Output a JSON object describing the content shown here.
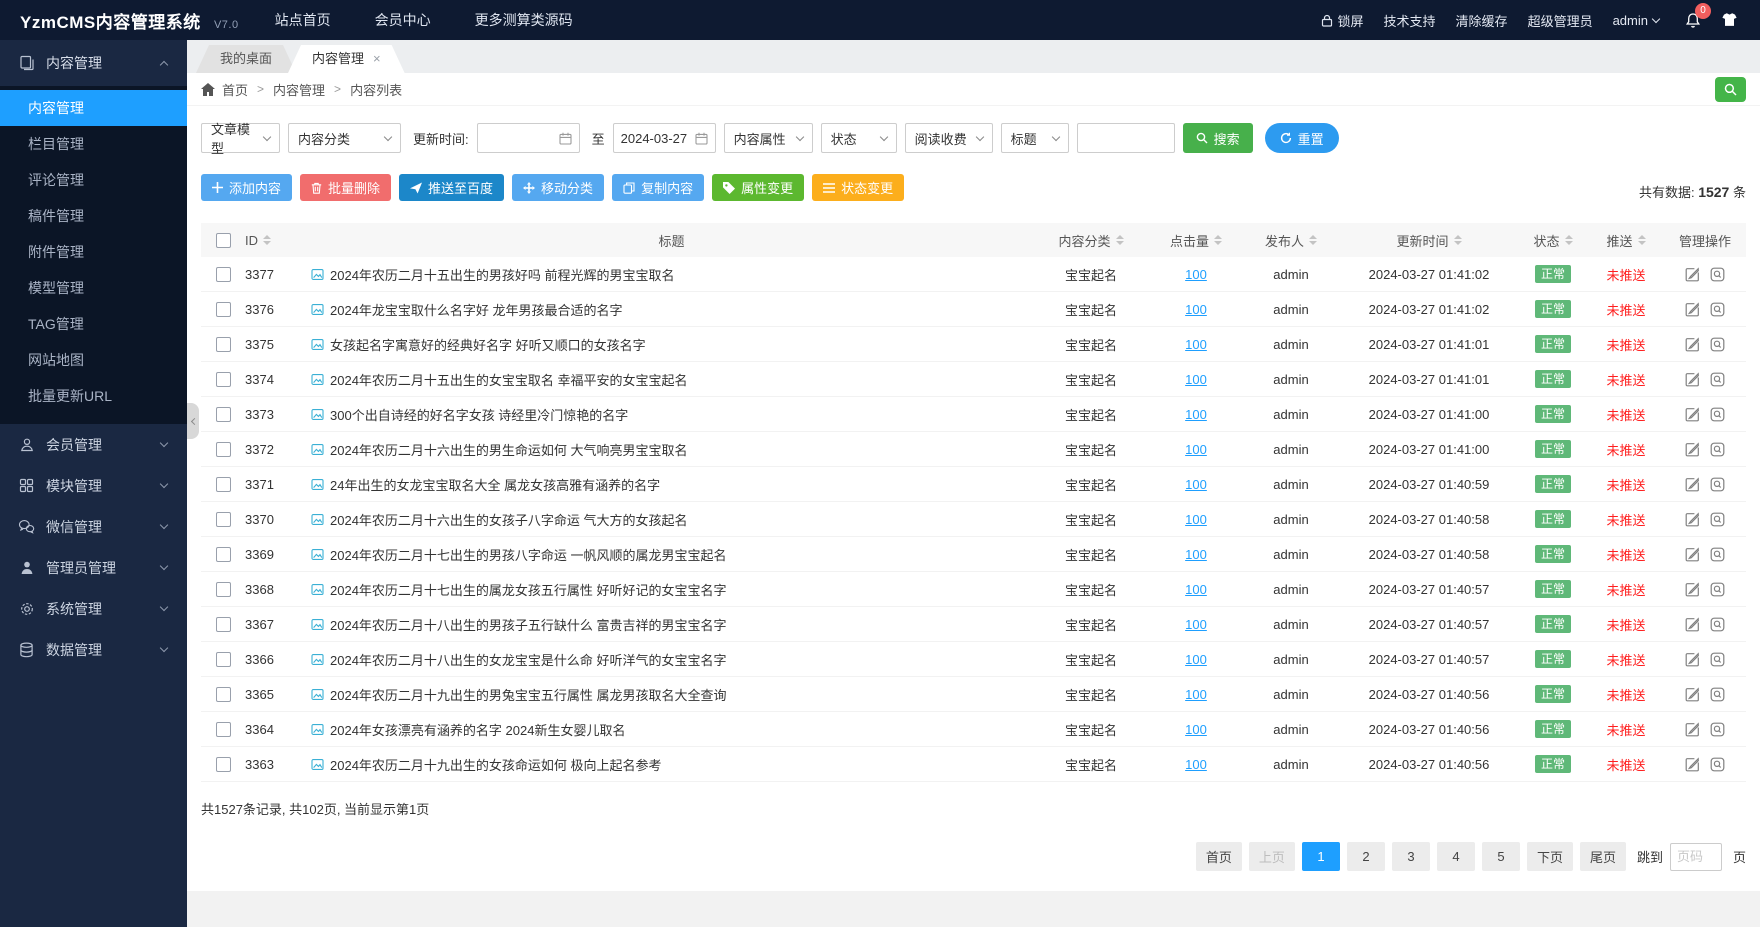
{
  "colors": {
    "topbar-bg": "#0e1a31",
    "sidebar-bg": "#1a2842",
    "submenu-bg": "#0b1526",
    "active-blue": "#1e9fff",
    "link-blue": "#1e9fff",
    "green": "#5FB878",
    "red-text": "#ff1f1f",
    "btn-blue": "#55a8f0",
    "btn-red": "#f16d6d",
    "btn-deepblue": "#1c87c9",
    "btn-green": "#5cb82f",
    "btn-orange": "#fcae1c",
    "search-green": "#47b04b",
    "reset-blue": "#2d9bf0",
    "crumb-btn-green": "#44b549",
    "badge-red": "#f25e5e",
    "page-active": "#1e9fff"
  },
  "topbar": {
    "brand": "YzmCMS内容管理系统",
    "version": "V7.0",
    "nav": [
      {
        "label": "站点首页"
      },
      {
        "label": "会员中心"
      },
      {
        "label": "更多测算类源码"
      }
    ],
    "lock": "锁屏",
    "support": "技术支持",
    "clear_cache": "清除缓存",
    "role": "超级管理员",
    "user": "admin",
    "notice_count": "0"
  },
  "sidebar": {
    "content_group": {
      "label": "内容管理"
    },
    "submenu": [
      {
        "label": "内容管理",
        "state": "active"
      },
      {
        "label": "栏目管理",
        "state": ""
      },
      {
        "label": "评论管理",
        "state": ""
      },
      {
        "label": "稿件管理",
        "state": ""
      },
      {
        "label": "附件管理",
        "state": ""
      },
      {
        "label": "模型管理",
        "state": ""
      },
      {
        "label": "TAG管理",
        "state": ""
      },
      {
        "label": "网站地图",
        "state": ""
      },
      {
        "label": "批量更新URL",
        "state": ""
      }
    ],
    "groups": [
      {
        "label": "会员管理"
      },
      {
        "label": "模块管理"
      },
      {
        "label": "微信管理"
      },
      {
        "label": "管理员管理"
      },
      {
        "label": "系统管理"
      },
      {
        "label": "数据管理"
      }
    ]
  },
  "tabs": {
    "desktop": "我的桌面",
    "content": "内容管理",
    "close": "×"
  },
  "breadcrumb": {
    "sep": ">",
    "items": [
      {
        "label": "首页"
      },
      {
        "label": "内容管理"
      },
      {
        "label": "内容列表"
      }
    ]
  },
  "filters": {
    "model": "文章模型",
    "category": "内容分类",
    "time_label": "更新时间:",
    "date_from": "",
    "date_to": "2024-03-27",
    "to": "至",
    "attribute": "内容属性",
    "status": "状态",
    "fee": "阅读收费",
    "field": "标题",
    "keyword": "",
    "search": "搜索",
    "reset": "重置"
  },
  "actions": {
    "add": "添加内容",
    "batch_delete": "批量删除",
    "push_baidu": "推送至百度",
    "move": "移动分类",
    "copy": "复制内容",
    "attr_change": "属性变更",
    "status_change": "状态变更"
  },
  "stats": {
    "total_label": "共有数据:",
    "total": "1527",
    "unit": "条"
  },
  "table": {
    "headers": [
      "ID",
      "标题",
      "内容分类",
      "点击量",
      "发布人",
      "更新时间",
      "状态",
      "推送",
      "管理操作"
    ],
    "rows": [
      {
        "id": "3377",
        "title": "2024年农历二月十五出生的男孩好吗 前程光辉的男宝宝取名",
        "category": "宝宝起名",
        "clicks": "100",
        "author": "admin",
        "time": "2024-03-27 01:41:02",
        "status": "正常",
        "push": "未推送"
      },
      {
        "id": "3376",
        "title": "2024年龙宝宝取什么名字好 龙年男孩最合适的名字",
        "category": "宝宝起名",
        "clicks": "100",
        "author": "admin",
        "time": "2024-03-27 01:41:02",
        "status": "正常",
        "push": "未推送"
      },
      {
        "id": "3375",
        "title": "女孩起名字寓意好的经典好名字 好听又顺口的女孩名字",
        "category": "宝宝起名",
        "clicks": "100",
        "author": "admin",
        "time": "2024-03-27 01:41:01",
        "status": "正常",
        "push": "未推送"
      },
      {
        "id": "3374",
        "title": "2024年农历二月十五出生的女宝宝取名 幸福平安的女宝宝起名",
        "category": "宝宝起名",
        "clicks": "100",
        "author": "admin",
        "time": "2024-03-27 01:41:01",
        "status": "正常",
        "push": "未推送"
      },
      {
        "id": "3373",
        "title": "300个出自诗经的好名字女孩 诗经里冷门惊艳的名字",
        "category": "宝宝起名",
        "clicks": "100",
        "author": "admin",
        "time": "2024-03-27 01:41:00",
        "status": "正常",
        "push": "未推送"
      },
      {
        "id": "3372",
        "title": "2024年农历二月十六出生的男生命运如何 大气响亮男宝宝取名",
        "category": "宝宝起名",
        "clicks": "100",
        "author": "admin",
        "time": "2024-03-27 01:41:00",
        "status": "正常",
        "push": "未推送"
      },
      {
        "id": "3371",
        "title": "24年出生的女龙宝宝取名大全 属龙女孩高雅有涵养的名字",
        "category": "宝宝起名",
        "clicks": "100",
        "author": "admin",
        "time": "2024-03-27 01:40:59",
        "status": "正常",
        "push": "未推送"
      },
      {
        "id": "3370",
        "title": "2024年农历二月十六出生的女孩子八字命运 气大方的女孩起名",
        "category": "宝宝起名",
        "clicks": "100",
        "author": "admin",
        "time": "2024-03-27 01:40:58",
        "status": "正常",
        "push": "未推送"
      },
      {
        "id": "3369",
        "title": "2024年农历二月十七出生的男孩八字命运 一帆风顺的属龙男宝宝起名",
        "category": "宝宝起名",
        "clicks": "100",
        "author": "admin",
        "time": "2024-03-27 01:40:58",
        "status": "正常",
        "push": "未推送"
      },
      {
        "id": "3368",
        "title": "2024年农历二月十七出生的属龙女孩五行属性 好听好记的女宝宝名字",
        "category": "宝宝起名",
        "clicks": "100",
        "author": "admin",
        "time": "2024-03-27 01:40:57",
        "status": "正常",
        "push": "未推送"
      },
      {
        "id": "3367",
        "title": "2024年农历二月十八出生的男孩子五行缺什么 富贵吉祥的男宝宝名字",
        "category": "宝宝起名",
        "clicks": "100",
        "author": "admin",
        "time": "2024-03-27 01:40:57",
        "status": "正常",
        "push": "未推送"
      },
      {
        "id": "3366",
        "title": "2024年农历二月十八出生的女龙宝宝是什么命 好听洋气的女宝宝名字",
        "category": "宝宝起名",
        "clicks": "100",
        "author": "admin",
        "time": "2024-03-27 01:40:57",
        "status": "正常",
        "push": "未推送"
      },
      {
        "id": "3365",
        "title": "2024年农历二月十九出生的男兔宝宝五行属性 属龙男孩取名大全查询",
        "category": "宝宝起名",
        "clicks": "100",
        "author": "admin",
        "time": "2024-03-27 01:40:56",
        "status": "正常",
        "push": "未推送"
      },
      {
        "id": "3364",
        "title": "2024年女孩漂亮有涵养的名字 2024新生女婴儿取名",
        "category": "宝宝起名",
        "clicks": "100",
        "author": "admin",
        "time": "2024-03-27 01:40:56",
        "status": "正常",
        "push": "未推送"
      },
      {
        "id": "3363",
        "title": "2024年农历二月十九出生的女孩命运如何 极向上起名参考",
        "category": "宝宝起名",
        "clicks": "100",
        "author": "admin",
        "time": "2024-03-27 01:40:56",
        "status": "正常",
        "push": "未推送"
      }
    ]
  },
  "footer": {
    "summary": "共1527条记录, 共102页, 当前显示第1页",
    "pages": [
      {
        "label": "首页",
        "cls": ""
      },
      {
        "label": "上页",
        "cls": "disabled"
      },
      {
        "label": "1",
        "cls": "active"
      },
      {
        "label": "2",
        "cls": ""
      },
      {
        "label": "3",
        "cls": ""
      },
      {
        "label": "4",
        "cls": ""
      },
      {
        "label": "5",
        "cls": ""
      },
      {
        "label": "下页",
        "cls": ""
      },
      {
        "label": "尾页",
        "cls": ""
      }
    ],
    "jump_label": "跳到",
    "jump_placeholder": "页码",
    "page_unit": "页"
  }
}
